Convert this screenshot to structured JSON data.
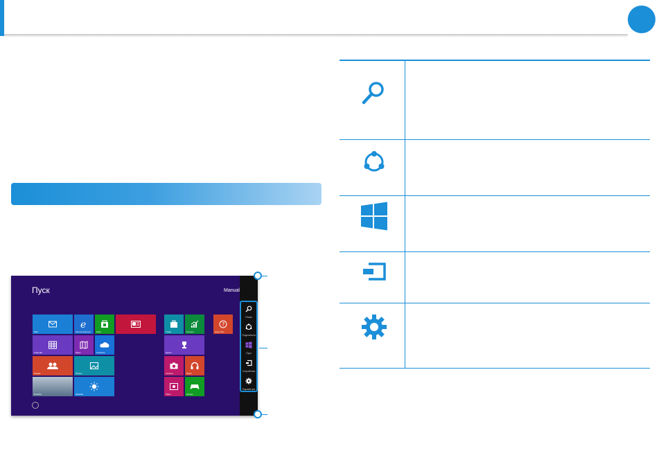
{
  "header": {
    "page_number": ""
  },
  "section": {
    "title": ""
  },
  "screenshot": {
    "start_title": "Пуск",
    "user_name": "Manual",
    "charms": [
      {
        "label": "Поиск",
        "icon": "search-icon"
      },
      {
        "label": "Поделиться",
        "icon": "share-icon"
      },
      {
        "label": "Пуск",
        "icon": "windows-start-icon"
      },
      {
        "label": "Устройства",
        "icon": "devices-icon"
      },
      {
        "label": "Параметры",
        "icon": "settings-icon"
      }
    ],
    "tiles": [
      {
        "label": "Mail",
        "color": "#1b7fd6"
      },
      {
        "label": "Internet Explorer",
        "color": "#1e6fd0"
      },
      {
        "label": "Store",
        "color": "#119c23"
      },
      {
        "label": "",
        "color": "#c3163c"
      },
      {
        "label": "Travel",
        "color": "#0f8fa6"
      },
      {
        "label": "Finance",
        "color": "#0c8a3c"
      },
      {
        "label": "Help+Tips",
        "color": "#d2462c"
      },
      {
        "label": "Calendar",
        "color": "#6a3bc1"
      },
      {
        "label": "Maps",
        "color": "#7d2cb2"
      },
      {
        "label": "OneDrive",
        "color": "#1872d8"
      },
      {
        "label": "Sports",
        "color": "#6a3bc1"
      },
      {
        "label": "People",
        "color": "#d2462c"
      },
      {
        "label": "Photos",
        "color": "#0f8fa6"
      },
      {
        "label": "Camera",
        "color": "#bd1a6b"
      },
      {
        "label": "Music",
        "color": "#d2462c"
      },
      {
        "label": "Desktop",
        "color": "#7a8fa6"
      },
      {
        "label": "Weather",
        "color": "#1b7fd6"
      },
      {
        "label": "Video",
        "color": "#bd1a6b"
      },
      {
        "label": "Games",
        "color": "#119c23"
      }
    ]
  },
  "table": {
    "rows": [
      {
        "icon": "search-icon",
        "text": ""
      },
      {
        "icon": "share-icon",
        "text": ""
      },
      {
        "icon": "windows-start-icon",
        "text": ""
      },
      {
        "icon": "devices-icon",
        "text": ""
      },
      {
        "icon": "settings-icon",
        "text": ""
      }
    ]
  },
  "colors": {
    "accent": "#1b8fd8",
    "start_bg": "#2a0f6a",
    "charm_bg": "#111111"
  }
}
